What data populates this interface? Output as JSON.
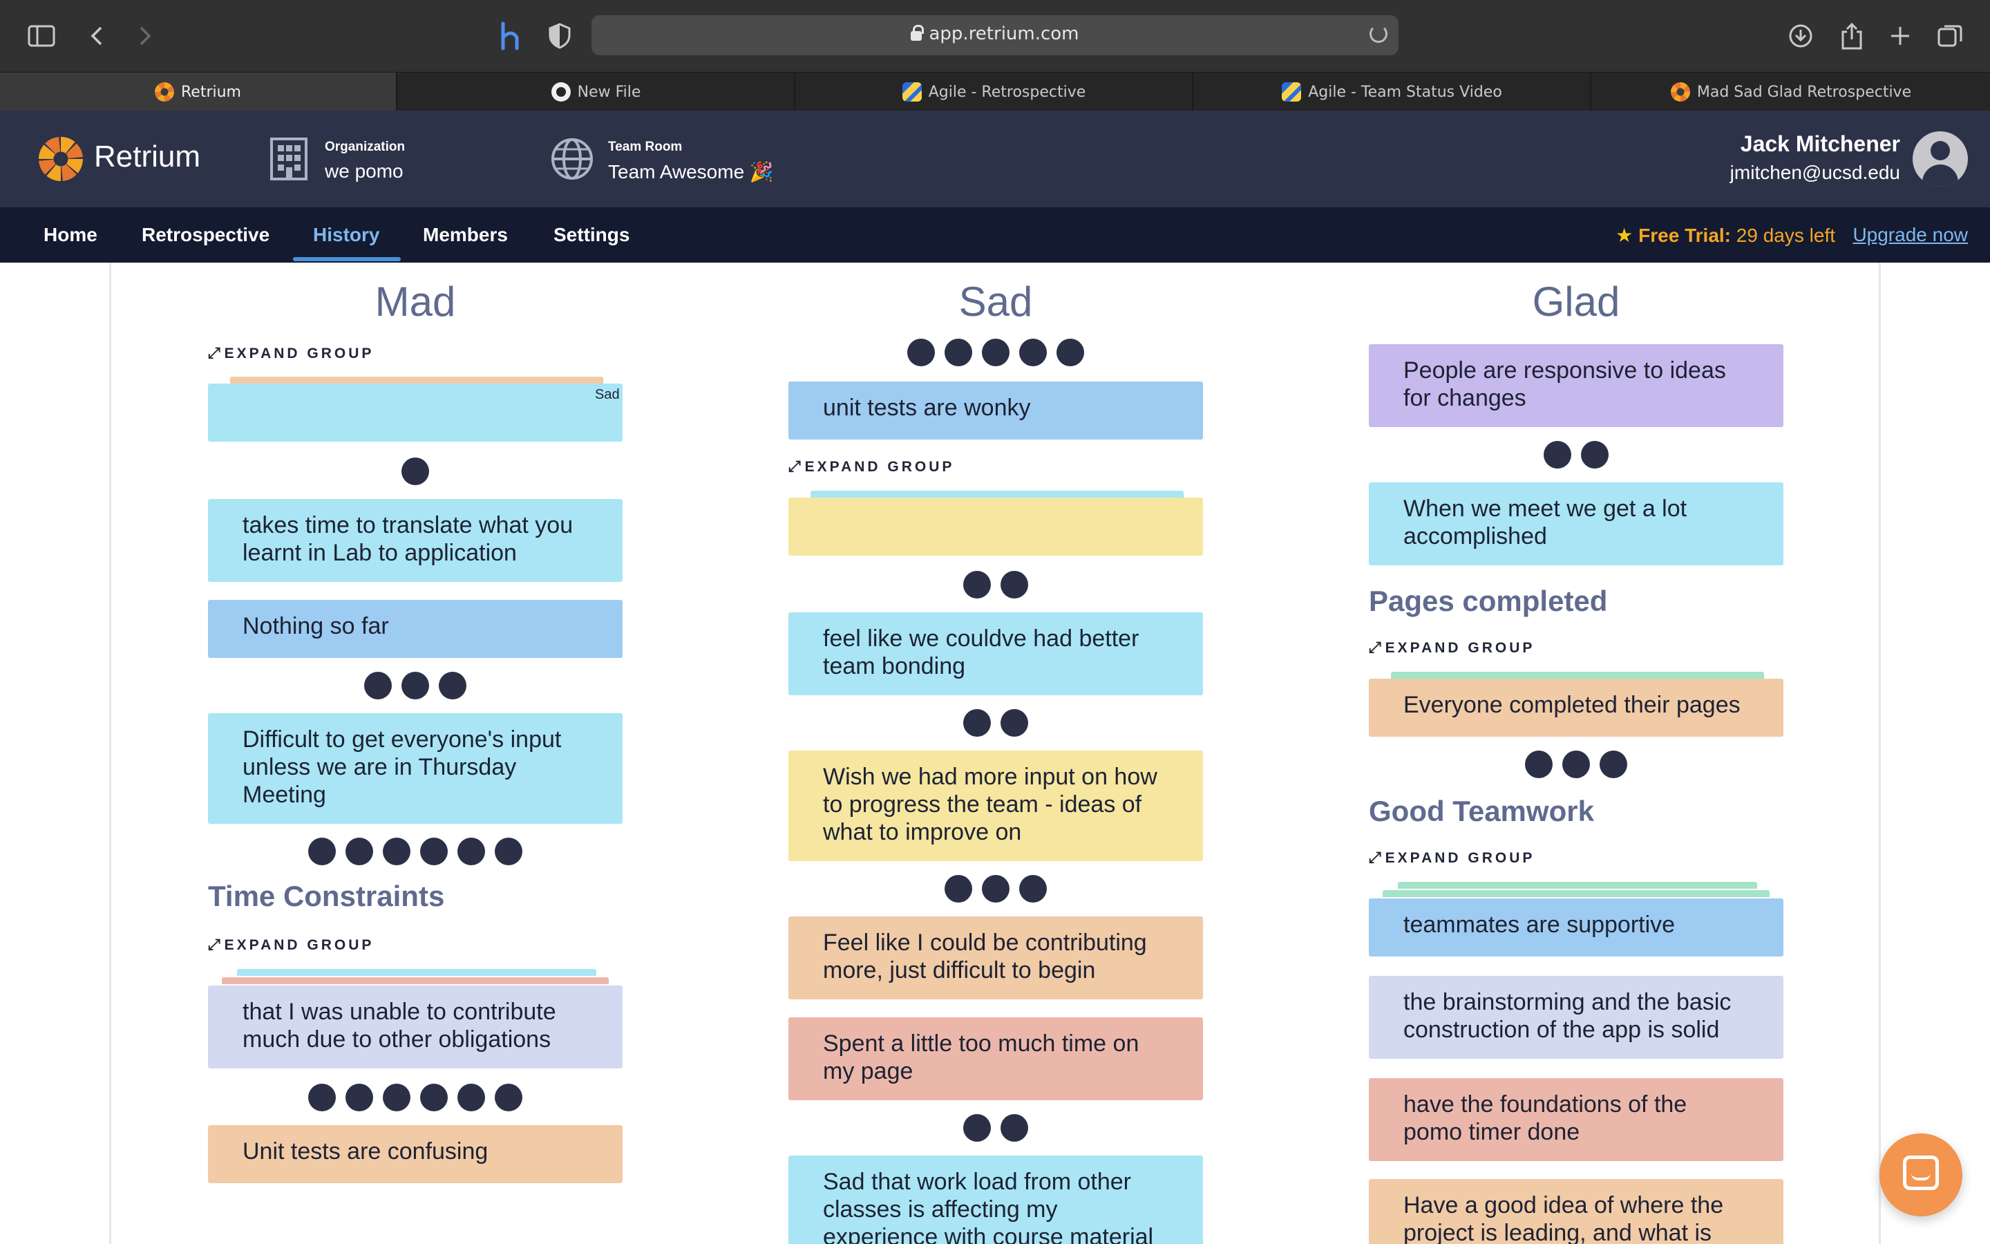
{
  "browser": {
    "url": "app.retrium.com",
    "tabs": [
      {
        "title": "Retrium",
        "favicon": "retrium-icon"
      },
      {
        "title": "New File",
        "favicon": "github-icon"
      },
      {
        "title": "Agile - Retrospective",
        "favicon": "agile-icon"
      },
      {
        "title": "Agile - Team Status Video",
        "favicon": "agile-icon"
      },
      {
        "title": "Mad Sad Glad Retrospective",
        "favicon": "retrium-icon"
      }
    ],
    "active_tab": 0
  },
  "header": {
    "brand": "Retrium",
    "organization_label": "Organization",
    "organization_name": "we pomo",
    "team_room_label": "Team Room",
    "team_room_name": "Team Awesome 🎉",
    "user_name": "Jack Mitchener",
    "user_email": "jmitchen@ucsd.edu"
  },
  "nav": {
    "items": [
      "Home",
      "Retrospective",
      "History",
      "Members",
      "Settings"
    ],
    "active": "History",
    "trial_label": "Free Trial:",
    "trial_days": "29 days left",
    "upgrade_label": "Upgrade now"
  },
  "board": {
    "expand_label": "EXPAND GROUP",
    "columns": [
      {
        "title": "Mad",
        "cards": [
          {
            "text": "",
            "tag": "Sad",
            "votes": 1
          },
          {
            "text": "takes time to translate what you learnt in Lab to application",
            "votes": 0
          },
          {
            "text": "Nothing so far",
            "votes": 3
          },
          {
            "text": "Difficult to get everyone's input unless we are in Thursday Meeting",
            "votes": 6
          }
        ],
        "groups": [
          {
            "title": "Time Constraints",
            "cards": [
              {
                "text": "that I was unable to contribute much due to other obligations",
                "votes": 6
              },
              {
                "text": "Unit tests are confusing",
                "votes": 0
              }
            ]
          }
        ]
      },
      {
        "title": "Sad",
        "cards": [
          {
            "text": "",
            "votes": 5,
            "votes_above": true
          },
          {
            "text": "unit tests are wonky",
            "votes": 0
          },
          {
            "text": "",
            "votes": 2
          },
          {
            "text": "feel like we couldve had better team bonding",
            "votes": 2
          },
          {
            "text": "Wish we had more input on how to progress the team - ideas of what to improve on",
            "votes": 3
          },
          {
            "text": "Feel like I could be contributing more, just difficult to begin",
            "votes": 0
          },
          {
            "text": "Spent a little too much time on my page",
            "votes": 2
          },
          {
            "text": "Sad that work load from other classes is affecting my experience with course material",
            "votes": 0
          }
        ]
      },
      {
        "title": "Glad",
        "cards": [
          {
            "text": "People are responsive to ideas for changes",
            "votes": 2
          },
          {
            "text": "When we meet we get a lot accomplished",
            "votes": 0
          }
        ],
        "groups": [
          {
            "title": "Pages completed",
            "cards": [
              {
                "text": "Everyone completed their pages",
                "votes": 3
              }
            ]
          },
          {
            "title": "Good Teamwork",
            "cards": [
              {
                "text": "teammates are supportive",
                "votes": 0
              },
              {
                "text": "the brainstorming and the basic construction of the app is solid",
                "votes": 0
              },
              {
                "text": "have the foundations of the pomo timer done",
                "votes": 0
              },
              {
                "text": "Have a good idea of where the project is leading, and what is",
                "votes": 0
              }
            ]
          }
        ]
      }
    ]
  },
  "colors": {
    "header_bg": "#2c3248",
    "nav_bg": "#141a30",
    "accent_orange": "#f5a623",
    "link_blue": "#7fb8ee",
    "vote_dot": "#2b3047",
    "card_cyan": "#a9e5f5",
    "card_blue": "#9ecbf1",
    "card_purple": "#c6b9ee",
    "card_yellow": "#f6e6a0",
    "card_peach": "#f1caa6",
    "card_salmon": "#ebb7aa",
    "card_lavender": "#d3d9f0",
    "card_green": "#a4e3c6"
  }
}
